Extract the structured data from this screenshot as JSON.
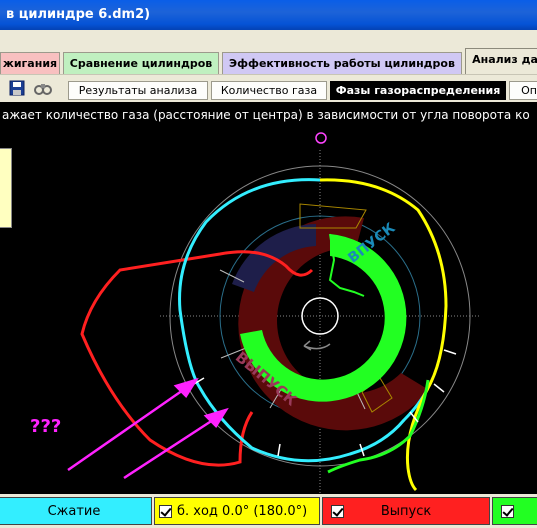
{
  "window": {
    "title": "в цилиндре 6.dm2)"
  },
  "top_tabs": [
    {
      "label": "жигания",
      "bg": "#f8c0c0"
    },
    {
      "label": "Сравнение цилиндров",
      "bg": "#c0f0c0"
    },
    {
      "label": "Эффективность работы цилиндров",
      "bg": "#d0c8f4"
    },
    {
      "label": "Анализ да",
      "bg": "#ece9d8",
      "active": true
    }
  ],
  "toolbar": {
    "icons": [
      "save-icon",
      "binoculars-icon"
    ]
  },
  "sub_tabs": [
    {
      "label": "Результаты анализа"
    },
    {
      "label": "Количество газа"
    },
    {
      "label": "Фазы газораспределения",
      "active": true
    },
    {
      "label": "Оп"
    }
  ],
  "description": "ажает количество газа (расстояние от центра) в зависимости от угла поворота ко",
  "chart": {
    "labels": {
      "intake": "ВПУСК",
      "exhaust": "ВЫПУСК",
      "question": "???"
    },
    "colors": {
      "compression": "#33eeff",
      "expansion": "#ffff00",
      "exhaust": "#ff2020",
      "intake": "#22ff22",
      "exhaust_band": "#5a0a0a",
      "annotation": "#ff22ff"
    }
  },
  "bottom_bar": [
    {
      "label": "Сжатие",
      "bg": "#33eeff",
      "checked": true
    },
    {
      "label": "б. ход 0.0° (180.0°)",
      "bg": "#ffff00",
      "checked": true
    },
    {
      "label": "Выпуск",
      "bg": "#ff2020",
      "checked": true
    },
    {
      "label": "",
      "bg": "#22ff22",
      "checked": true
    }
  ]
}
